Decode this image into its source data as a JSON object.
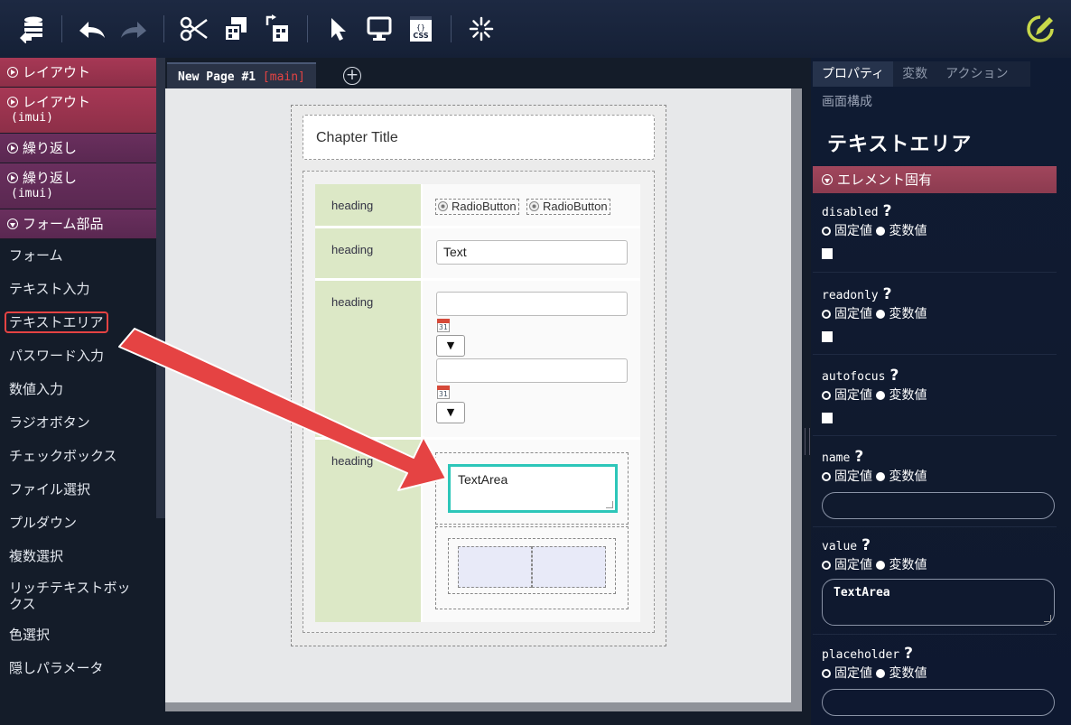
{
  "toolbar": {
    "icons": [
      "database-icon",
      "undo-icon",
      "redo-icon",
      "cut-icon",
      "copy-icon",
      "paste-icon",
      "pointer-icon",
      "preview-icon",
      "css-icon",
      "loading-icon",
      "edit-icon"
    ],
    "css_label": "CSS"
  },
  "palette": {
    "groups": [
      {
        "label": "レイアウト",
        "sub": ""
      },
      {
        "label": "レイアウト",
        "sub": "(imui)"
      },
      {
        "label": "繰り返し",
        "sub": ""
      },
      {
        "label": "繰り返し",
        "sub": "(imui)"
      },
      {
        "label": "フォーム部品",
        "sub": ""
      }
    ],
    "items": [
      "フォーム",
      "テキスト入力",
      "テキストエリア",
      "パスワード入力",
      "数値入力",
      "ラジオボタン",
      "チェックボックス",
      "ファイル選択",
      "プルダウン",
      "複数選択",
      "リッチテキストボックス",
      "色選択",
      "隠しパラメータ"
    ],
    "selected_index": 2
  },
  "tabs": {
    "page_name": "New Page #1",
    "branch": "[main]",
    "add": "+"
  },
  "canvas": {
    "chapter_title": "Chapter Title",
    "rows": [
      {
        "heading": "heading"
      },
      {
        "heading": "heading"
      },
      {
        "heading": "heading"
      },
      {
        "heading": "heading"
      }
    ],
    "radio_label_1": "RadioButton",
    "radio_label_2": "RadioButton",
    "text_value": "Text",
    "calendar_day": "31",
    "select_arrow": "▼",
    "textarea_value": "TextArea"
  },
  "props": {
    "tabs": [
      "プロパティ",
      "変数",
      "アクション"
    ],
    "breadcrumb": "画面構成",
    "component_title": "テキストエリア",
    "section": "エレメント固有",
    "fixed_label": "固定値",
    "variable_label": "変数値",
    "help": "?",
    "items": [
      {
        "name": "disabled",
        "control": "checkbox",
        "value": ""
      },
      {
        "name": "readonly",
        "control": "checkbox",
        "value": ""
      },
      {
        "name": "autofocus",
        "control": "checkbox",
        "value": ""
      },
      {
        "name": "name",
        "control": "input",
        "value": ""
      },
      {
        "name": "value",
        "control": "textarea",
        "value": "TextArea"
      },
      {
        "name": "placeholder",
        "control": "input",
        "value": ""
      }
    ]
  },
  "colors": {
    "accent_teal": "#2dc6b9",
    "arrow_red": "#e54343",
    "group_red": "#a73855",
    "group_purple": "#6a2f5e",
    "heading_green": "#dce8c6",
    "edit_icon": "#c8d84a"
  }
}
